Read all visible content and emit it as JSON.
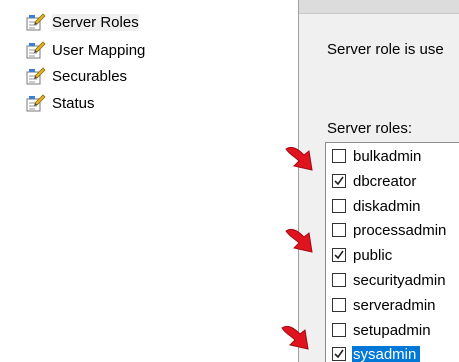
{
  "nav": {
    "items": [
      {
        "label": "Server Roles",
        "icon": "properties-page-icon",
        "selected": true
      },
      {
        "label": "User Mapping",
        "icon": "properties-page-icon",
        "selected": false
      },
      {
        "label": "Securables",
        "icon": "properties-page-icon",
        "selected": false
      },
      {
        "label": "Status",
        "icon": "properties-page-icon",
        "selected": false
      }
    ]
  },
  "content": {
    "description": "Server role is use",
    "roles_caption": "Server roles:",
    "roles": [
      {
        "name": "bulkadmin",
        "checked": false,
        "highlighted": false
      },
      {
        "name": "dbcreator",
        "checked": true,
        "highlighted": false
      },
      {
        "name": "diskadmin",
        "checked": false,
        "highlighted": false
      },
      {
        "name": "processadmin",
        "checked": false,
        "highlighted": false
      },
      {
        "name": "public",
        "checked": true,
        "highlighted": false
      },
      {
        "name": "securityadmin",
        "checked": false,
        "highlighted": false
      },
      {
        "name": "serveradmin",
        "checked": false,
        "highlighted": false
      },
      {
        "name": "setupadmin",
        "checked": false,
        "highlighted": false
      },
      {
        "name": "sysadmin",
        "checked": true,
        "highlighted": true
      }
    ]
  },
  "annotations": {
    "arrow_color": "#e0141e",
    "arrow_icon": "red-pointer-arrow-icon",
    "pointing_to": [
      "dbcreator",
      "public",
      "sysadmin"
    ]
  },
  "colors": {
    "selection_blue": "#0078d7",
    "panel_gray": "#f0f0f0"
  }
}
